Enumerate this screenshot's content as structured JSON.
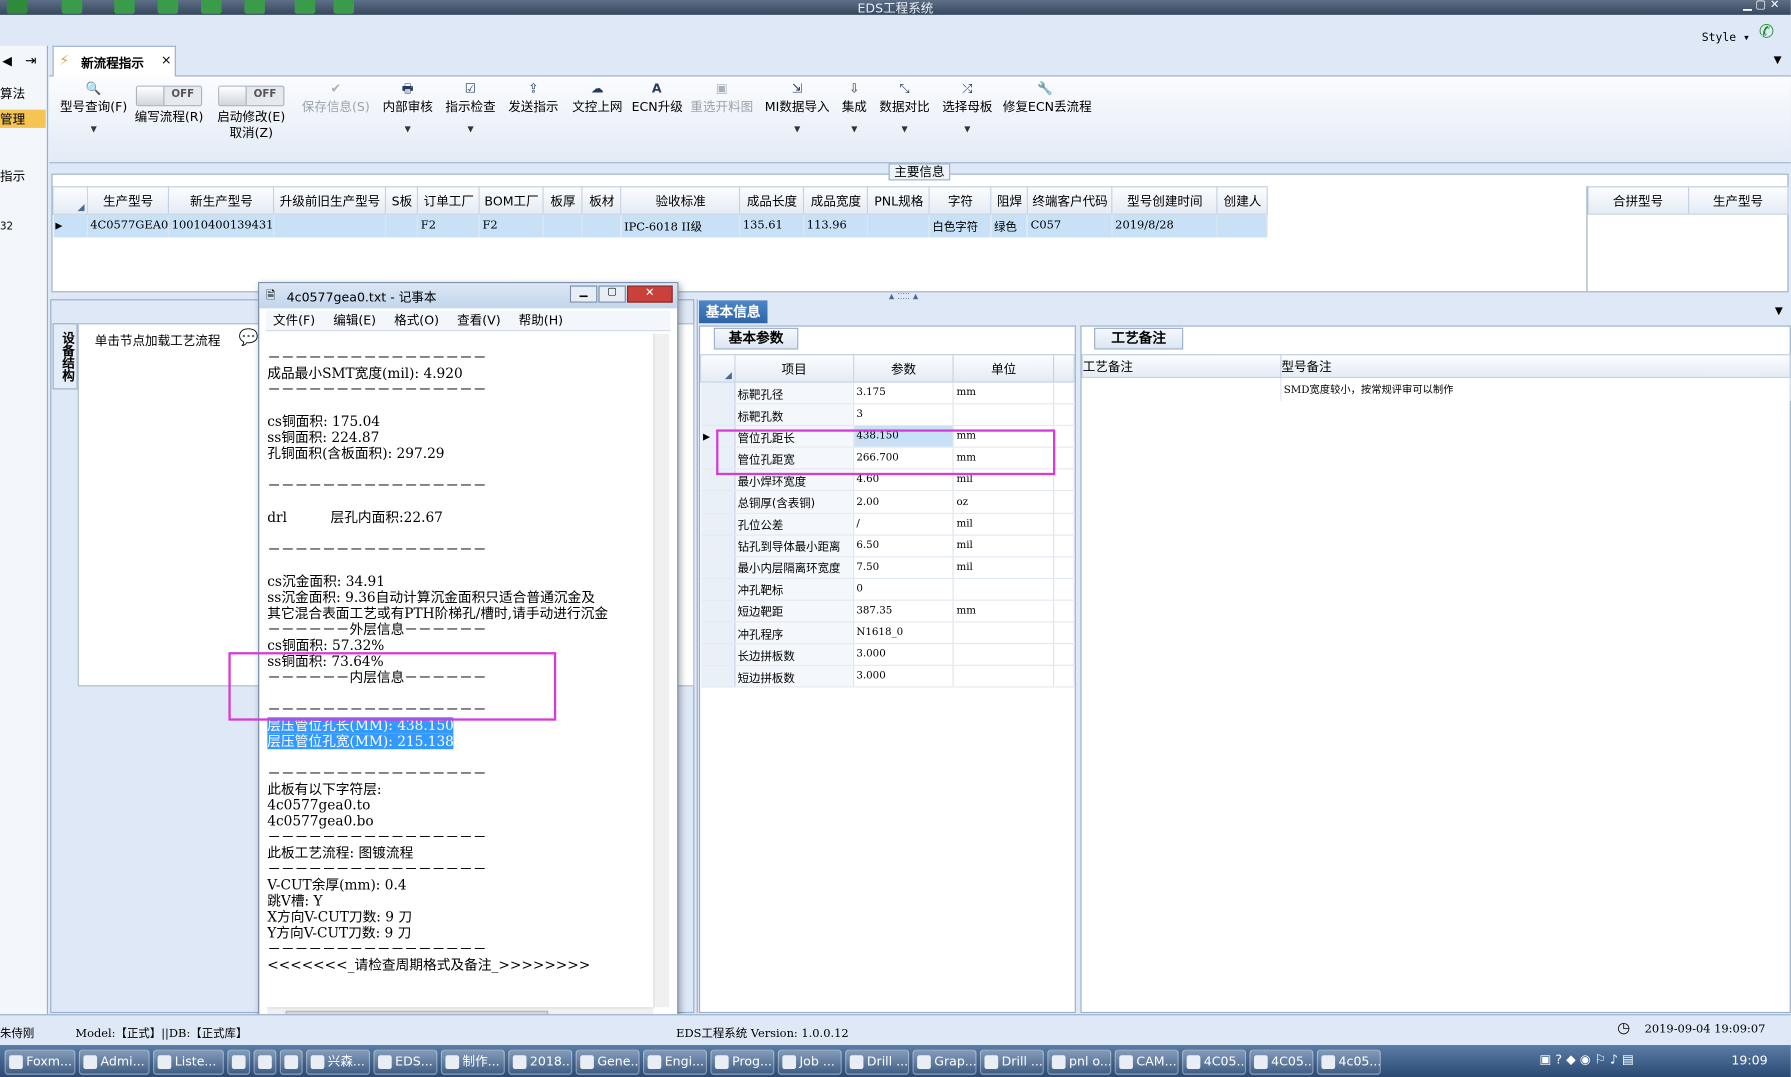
{
  "window": {
    "title": "EDS工程系统",
    "style_label": "Style"
  },
  "left_strip": {
    "items": [
      "算法",
      "管理",
      "指示",
      "",
      "32"
    ]
  },
  "tab": {
    "label": "新流程指示",
    "close": "×"
  },
  "ribbon": {
    "buttons": [
      {
        "label": "型号查询(F)",
        "icon": "search-icon",
        "dropdown": true
      },
      {
        "label": "编写流程(R)",
        "toggle": "OFF"
      },
      {
        "label": "启动修改(E)",
        "label2": "取消(Z)",
        "toggle": "OFF"
      },
      {
        "label": "保存信息(S)",
        "icon": "check-icon",
        "disabled": true
      },
      {
        "label": "内部审核",
        "icon": "print-icon",
        "dropdown": true
      },
      {
        "label": "指示检查",
        "icon": "checkbox-icon",
        "dropdown": true
      },
      {
        "label": "发送指示",
        "icon": "upload-icon"
      },
      {
        "label": "文控上网",
        "icon": "cloud-upload-icon"
      },
      {
        "label": "ECN升级",
        "icon": "font-icon"
      },
      {
        "label": "重选开料图",
        "icon": "image-icon",
        "disabled": true
      },
      {
        "label": "MI数据导入",
        "icon": "import-icon",
        "dropdown": true
      },
      {
        "label": "集成",
        "icon": "download-icon",
        "dropdown": true
      },
      {
        "label": "数据对比",
        "icon": "compare-icon",
        "dropdown": true
      },
      {
        "label": "选择母板",
        "icon": "shuffle-icon",
        "dropdown": true
      },
      {
        "label": "修复ECN丢流程",
        "icon": "wrench-icon"
      }
    ]
  },
  "main_info": {
    "label": "主要信息",
    "columns": [
      "生产型号",
      "新生产型号",
      "升级前旧生产型号",
      "S板",
      "订单工厂",
      "BOM工厂",
      "板厚",
      "板材",
      "验收标准",
      "成品长度",
      "成品宽度",
      "PNL规格",
      "字符",
      "阻焊",
      "终端客户代码",
      "型号创建时间",
      "创建人"
    ],
    "row": [
      "4C0577GEA0",
      "10010400139431",
      "",
      "",
      "F2",
      "F2",
      "",
      "",
      "IPC-6018 II级",
      "135.61",
      "113.96",
      "",
      "白色字符",
      "绿色",
      "C057",
      "2019/8/28",
      ""
    ],
    "merge_columns": [
      "合拼型号",
      "生产型号"
    ]
  },
  "flow_panel": {
    "vertical_tab": "设备结构",
    "hint": "单击节点加载工艺流程"
  },
  "basic_info": {
    "header": "基本信息",
    "tab": "基本参数",
    "columns": [
      "项目",
      "参数",
      "单位"
    ],
    "rows": [
      [
        "标靶孔径",
        "3.175",
        "mm"
      ],
      [
        "标靶孔数",
        "3",
        ""
      ],
      [
        "管位孔距长",
        "438.150",
        "mm"
      ],
      [
        "管位孔距宽",
        "266.700",
        "mm"
      ],
      [
        "最小焊环宽度",
        "4.60",
        "mil"
      ],
      [
        "总铜厚(含表铜)",
        "2.00",
        "oz"
      ],
      [
        "孔位公差",
        "/",
        "mil"
      ],
      [
        "钻孔到导体最小距离",
        "6.50",
        "mil"
      ],
      [
        "最小内层隔离环宽度",
        "7.50",
        "mil"
      ],
      [
        "冲孔靶标",
        "0",
        ""
      ],
      [
        "短边靶距",
        "387.35",
        "mm"
      ],
      [
        "冲孔程序",
        "N1618_0",
        ""
      ],
      [
        "长边拼板数",
        "3.000",
        ""
      ],
      [
        "短边拼板数",
        "3.000",
        ""
      ]
    ]
  },
  "craft": {
    "tab": "工艺备注",
    "col1": "工艺备注",
    "col2": "型号备注",
    "note": "SMD宽度较小，按常规评审可以制作"
  },
  "notepad": {
    "title": "4c0577gea0.txt - 记事本",
    "menu": [
      "文件(F)",
      "编辑(E)",
      "格式(O)",
      "查看(V)",
      "帮助(H)"
    ],
    "lines_before": [
      "",
      "－－－－－－－－－－－－－－－－",
      "成品最小SMT宽度(mil): 4.920",
      "－－－－－－－－－－－－－－－－",
      "",
      "cs铜面积: 175.04",
      "ss铜面积: 224.87",
      "孔铜面积(含板面积): 297.29",
      "",
      "－－－－－－－－－－－－－－－－",
      "",
      "drl          层孔内面积:22.67",
      "",
      "－－－－－－－－－－－－－－－－",
      "",
      "cs沉金面积: 34.91",
      "ss沉金面积: 9.36自动计算沉金面积只适合普通沉金及",
      "其它混合表面工艺或有PTH阶梯孔/槽时,请手动进行沉金",
      "－－－－－－外层信息－－－－－－",
      "cs铜面积: 57.32%",
      "ss铜面积: 73.64%",
      "－－－－－－内层信息－－－－－－",
      "",
      "－－－－－－－－－－－－－－－－"
    ],
    "hl1": "层压管位孔长(MM): 438.150",
    "hl2": "层压管位孔宽(MM): 215.138",
    "lines_after": [
      "",
      "－－－－－－－－－－－－－－－－",
      "此板有以下字符层:",
      "4c0577gea0.to",
      "4c0577gea0.bo",
      "－－－－－－－－－－－－－－－－",
      "此板工艺流程: 图镀流程",
      "－－－－－－－－－－－－－－－－",
      "V-CUT余厚(mm): 0.4",
      "跳V槽: Y",
      "X方向V-CUT刀数: 9 刀",
      "Y方向V-CUT刀数: 9 刀",
      "－－－－－－－－－－－－－－－－",
      "<<<<<<<_请检查周期格式及备注_>>>>>>>>"
    ]
  },
  "status": {
    "user": "朱侍刚",
    "model": "Model:【正式】||DB:【正式库】",
    "system": "EDS工程系统 Version: 1.0.0.12",
    "datetime": "2019-09-04 19:09:07"
  },
  "taskbar": {
    "items": [
      "Foxm...",
      "Admi...",
      "Liste...",
      "",
      "",
      "",
      "兴森...",
      "EDS...",
      "制作...",
      "2018...",
      "Gene...",
      "Engi...",
      "Prog...",
      "Job ...",
      "Drill ...",
      "Grap...",
      "Drill ...",
      "pnl o...",
      "CAM...",
      "4C05...",
      "4C05...",
      "4c05..."
    ],
    "clock": "19:09"
  }
}
